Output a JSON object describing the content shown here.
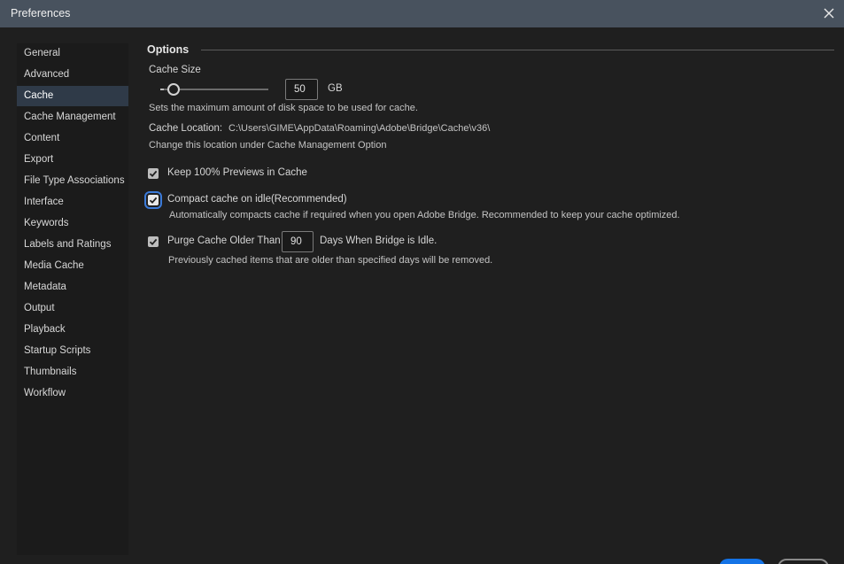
{
  "window": {
    "title": "Preferences"
  },
  "sidebar": {
    "items": [
      {
        "label": "General"
      },
      {
        "label": "Advanced"
      },
      {
        "label": "Cache"
      },
      {
        "label": "Cache Management"
      },
      {
        "label": "Content"
      },
      {
        "label": "Export"
      },
      {
        "label": "File Type Associations"
      },
      {
        "label": "Interface"
      },
      {
        "label": "Keywords"
      },
      {
        "label": "Labels and Ratings"
      },
      {
        "label": "Media Cache"
      },
      {
        "label": "Metadata"
      },
      {
        "label": "Output"
      },
      {
        "label": "Playback"
      },
      {
        "label": "Startup Scripts"
      },
      {
        "label": "Thumbnails"
      },
      {
        "label": "Workflow"
      }
    ],
    "selected": "Cache"
  },
  "options": {
    "header": "Options",
    "cache_size": {
      "label": "Cache Size",
      "value": "50",
      "unit": "GB",
      "description": "Sets the maximum amount of disk space to be used for cache."
    },
    "cache_location": {
      "label": "Cache Location:",
      "path": "C:\\Users\\GIME\\AppData\\Roaming\\Adobe\\Bridge\\Cache\\v36\\",
      "note": "Change this location under Cache Management Option"
    },
    "keep_previews": {
      "label": "Keep 100% Previews in Cache",
      "checked": true
    },
    "compact_cache": {
      "label": "Compact cache on idle(Recommended)",
      "checked": true,
      "description": "Automatically compacts cache if required when you open Adobe Bridge. Recommended to keep your cache optimized."
    },
    "purge_cache": {
      "label_before": "Purge Cache Older Than",
      "days": "90",
      "label_after": "Days When Bridge is Idle.",
      "checked": true,
      "description": "Previously cached items that are older than specified days will be removed."
    }
  },
  "colors": {
    "titlebar": "#48525e",
    "background": "#1f1f1f",
    "sidebar_selected": "#2f3a48",
    "focus_accent": "#3b7ad8",
    "primary_button": "#1473e6"
  },
  "icons": {
    "close": "close-icon",
    "checkmark": "checkmark-icon"
  }
}
